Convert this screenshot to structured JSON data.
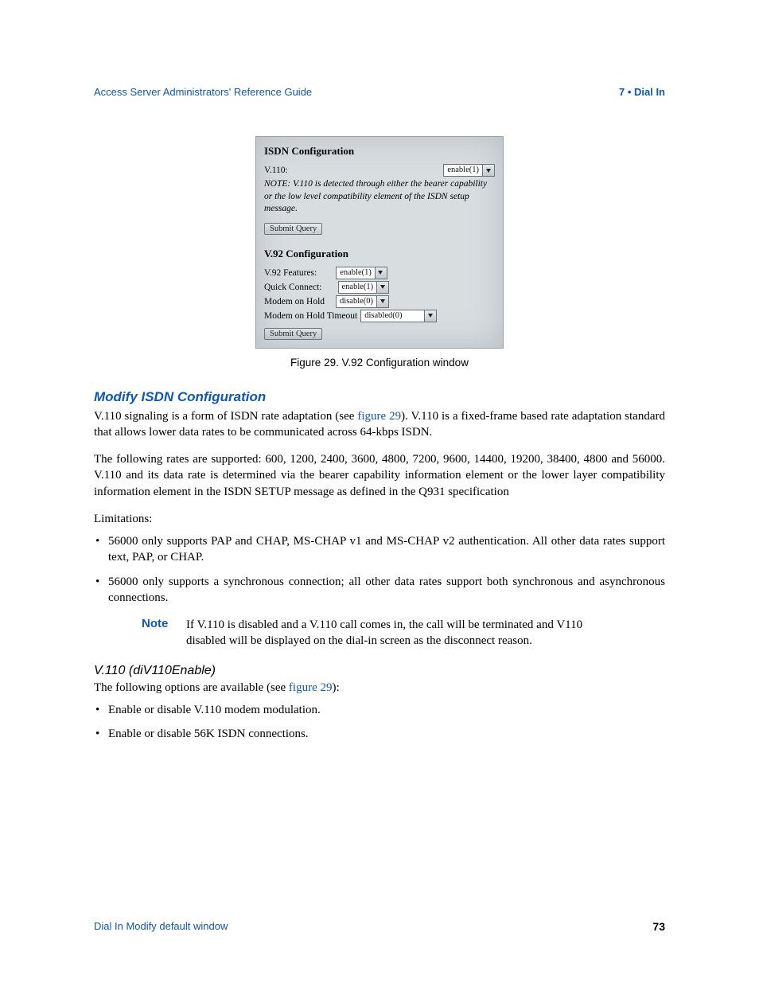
{
  "header": {
    "left": "Access Server Administrators' Reference Guide",
    "right": "7 • Dial In"
  },
  "figure": {
    "isdn": {
      "title": "ISDN Configuration",
      "v110_label": "V.110:",
      "v110_value": "enable(1)",
      "note": "NOTE: V.110 is detected through either the bearer capability or the low level compatibility element of the ISDN setup message.",
      "submit": "Submit Query"
    },
    "v92": {
      "title": "V.92 Configuration",
      "rows": [
        {
          "label": "V.92 Features:",
          "value": "enable(1)"
        },
        {
          "label": "Quick Connect:",
          "value": "enable(1)"
        },
        {
          "label": "Modem on Hold",
          "value": "disable(0)"
        },
        {
          "label": "Modem on Hold Timeout",
          "value": "disabled(0)"
        }
      ],
      "submit": "Submit Query"
    },
    "caption": "Figure 29. V.92 Configuration window"
  },
  "section": {
    "heading": "Modify ISDN Configuration",
    "p1a": "V.110 signaling is a form of ISDN rate adaptation (see ",
    "p1link": "figure 29",
    "p1b": "). V.110 is a fixed-frame based rate adaptation standard that allows lower data rates to be communicated across 64-kbps ISDN.",
    "p2": "The following rates are supported: 600, 1200, 2400, 3600, 4800, 7200, 9600, 14400, 19200, 38400, 4800 and 56000. V.110 and its data rate is determined via the bearer capability information element or the lower layer compatibility information element in the ISDN SETUP message as defined in the Q931 specification",
    "limitations_label": "Limitations:",
    "bullets1": [
      "56000 only supports PAP and CHAP, MS-CHAP v1 and MS-CHAP v2 authentication. All other data rates support text, PAP, or CHAP.",
      "56000 only supports a synchronous connection; all other data rates support both synchronous and asynchronous connections."
    ],
    "note_label": "Note",
    "note_body": "If V.110 is disabled and a V.110 call comes in, the call will be terminated and V110 disabled will be displayed on the dial-in screen as the disconnect reason.",
    "sub_heading": "V.110 (diV110Enable)",
    "p3a": "The following options are available (see ",
    "p3link": "figure 29",
    "p3b": "):",
    "bullets2": [
      "Enable or disable V.110 modem modulation.",
      "Enable or disable 56K ISDN connections."
    ]
  },
  "footer": {
    "left": "Dial In Modify default window",
    "page": "73"
  }
}
